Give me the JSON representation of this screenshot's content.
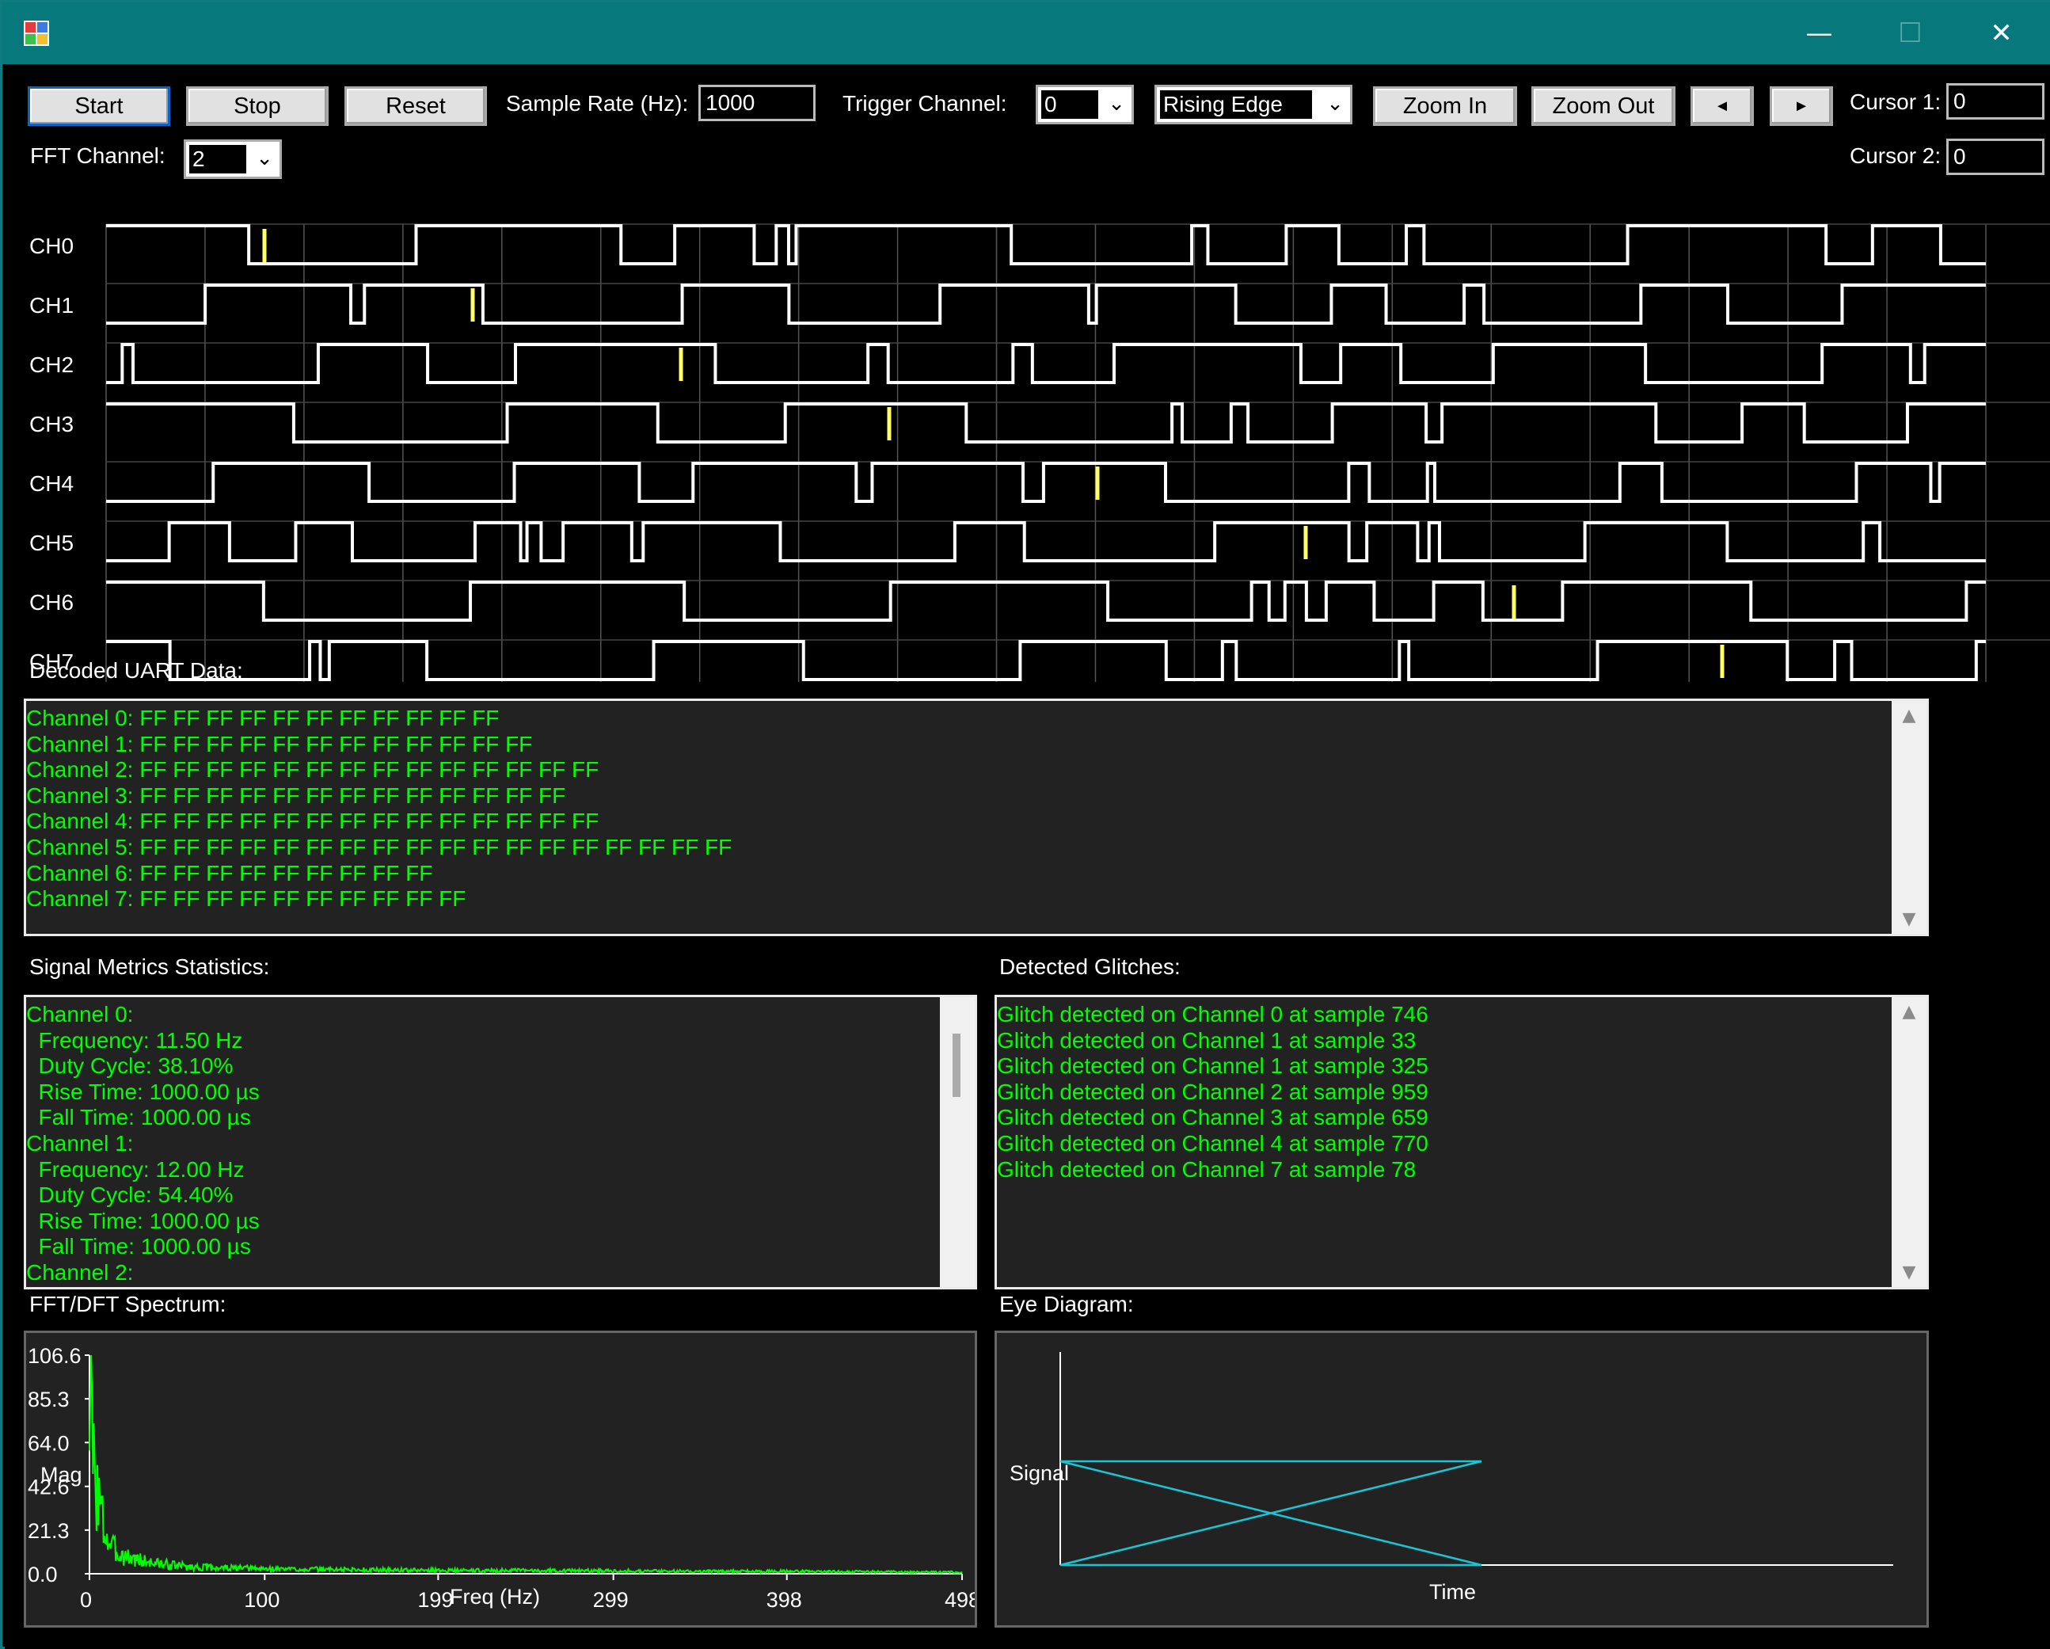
{
  "window": {
    "min_glyph": "—",
    "max_glyph": "☐",
    "close_glyph": "✕"
  },
  "toolbar": {
    "start": "Start",
    "stop": "Stop",
    "reset": "Reset",
    "sample_rate_label": "Sample Rate (Hz):",
    "sample_rate": "1000",
    "trigger_channel_label": "Trigger Channel:",
    "trigger_channel": "0",
    "trigger_edge": "Rising Edge",
    "zoom_in": "Zoom In",
    "zoom_out": "Zoom Out",
    "left": "◄",
    "right": "►",
    "cursor1_label": "Cursor 1:",
    "cursor1": "0",
    "fft_channel_label": "FFT Channel:",
    "fft_channel": "2",
    "cursor2_label": "Cursor 2:",
    "cursor2": "0"
  },
  "channels": [
    "CH0",
    "CH1",
    "CH2",
    "CH3",
    "CH4",
    "CH5",
    "CH6",
    "CH7"
  ],
  "uart": {
    "label": "Decoded UART Data:",
    "lines": [
      "Channel 0: FF FF FF FF FF FF FF FF FF FF FF",
      "Channel 1: FF FF FF FF FF FF FF FF FF FF FF FF",
      "Channel 2: FF FF FF FF FF FF FF FF FF FF FF FF FF FF",
      "Channel 3: FF FF FF FF FF FF FF FF FF FF FF FF FF",
      "Channel 4: FF FF FF FF FF FF FF FF FF FF FF FF FF FF",
      "Channel 5: FF FF FF FF FF FF FF FF FF FF FF FF FF FF FF FF FF FF",
      "Channel 6: FF FF FF FF FF FF FF FF FF",
      "Channel 7: FF FF FF FF FF FF FF FF FF FF"
    ]
  },
  "metrics": {
    "label": "Signal Metrics  Statistics:",
    "lines": [
      "Channel 0:",
      "  Frequency: 11.50 Hz",
      "  Duty Cycle: 38.10%",
      "  Rise Time: 1000.00 µs",
      "  Fall Time: 1000.00 µs",
      "Channel 1:",
      "  Frequency: 12.00 Hz",
      "  Duty Cycle: 54.40%",
      "  Rise Time: 1000.00 µs",
      "  Fall Time: 1000.00 µs",
      "Channel 2:"
    ]
  },
  "glitches": {
    "label": "Detected Glitches:",
    "lines": [
      "Glitch detected on Channel 0 at sample 746",
      "Glitch detected on Channel 1 at sample 33",
      "Glitch detected on Channel 1 at sample 325",
      "Glitch detected on Channel 2 at sample 959",
      "Glitch detected on Channel 3 at sample 659",
      "Glitch detected on Channel 4 at sample 770",
      "Glitch detected on Channel 7 at sample 78"
    ]
  },
  "scroll": {
    "up": "▲",
    "down": "▼"
  },
  "colors": {
    "waveform": "#ffffff",
    "glitch": "#ffff66",
    "text_green": "#00ff00",
    "spectrum": "#00ff00",
    "eye": "#19c6d6",
    "panel_bg": "#222222"
  },
  "fft": {
    "label": "FFT/DFT Spectrum:",
    "y_ticks": [
      "106.6",
      "85.3",
      "64.0",
      "42.6",
      "21.3",
      "0.0"
    ],
    "x_ticks": [
      "0",
      "100",
      "199",
      "299",
      "398",
      "498"
    ],
    "xlabel": "Freq (Hz)",
    "ylabel": "Mag"
  },
  "eye": {
    "label": "Eye Diagram:",
    "ylabel": "Signal",
    "xlabel": "Time"
  },
  "chart_data": [
    {
      "type": "line",
      "title": "FFT/DFT Spectrum:",
      "xlabel": "Freq (Hz)",
      "ylabel": "Mag",
      "xlim": [
        0,
        498
      ],
      "ylim": [
        0,
        106.6
      ],
      "x_ticks": [
        0,
        100,
        199,
        299,
        398,
        498
      ],
      "y_ticks": [
        0.0,
        21.3,
        42.6,
        64.0,
        85.3,
        106.6
      ],
      "series": [
        {
          "x": [
            0,
            1,
            2,
            3,
            4,
            5,
            6,
            7,
            8,
            9,
            10,
            12,
            14,
            16,
            18,
            20,
            25,
            30,
            35,
            40,
            50,
            60,
            80,
            100,
            150,
            200,
            250,
            300,
            350,
            400,
            450,
            498
          ],
          "y": [
            106.6,
            95,
            70,
            60,
            55,
            48,
            40,
            35,
            30,
            25,
            22,
            18,
            15,
            13,
            12,
            11,
            9,
            8,
            7,
            6,
            5,
            4,
            3.5,
            3,
            2.5,
            2,
            2,
            1.8,
            1.5,
            1.5,
            1.2,
            1
          ]
        }
      ]
    },
    {
      "type": "line",
      "title": "Eye Diagram:",
      "xlabel": "Time",
      "ylabel": "Signal",
      "series": [
        {
          "x": [
            0,
            1
          ],
          "y": [
            1,
            1
          ]
        },
        {
          "x": [
            0,
            1
          ],
          "y": [
            0,
            0
          ]
        },
        {
          "x": [
            0,
            1
          ],
          "y": [
            1,
            0
          ]
        },
        {
          "x": [
            0,
            1
          ],
          "y": [
            0,
            1
          ]
        }
      ]
    }
  ]
}
